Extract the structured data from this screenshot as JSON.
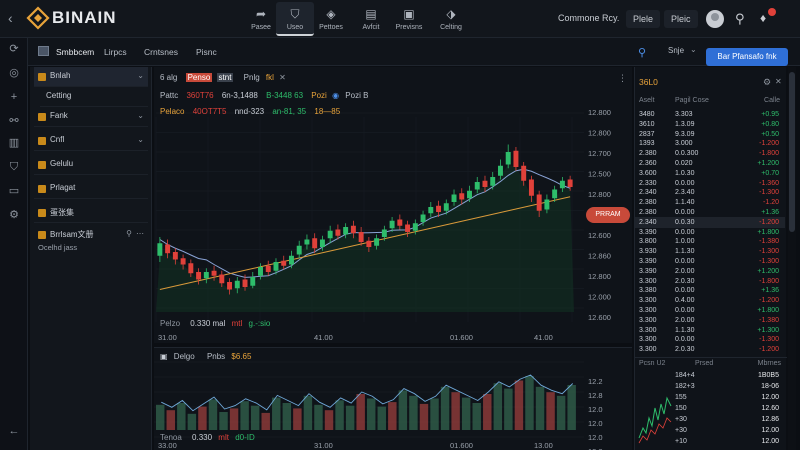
{
  "brand": {
    "name": "BINAIN"
  },
  "nav": [
    {
      "label": "Pasee",
      "icon": "share-icon"
    },
    {
      "label": "Useo",
      "icon": "shield-icon"
    },
    {
      "label": "Pettoes",
      "icon": "cube-icon"
    },
    {
      "label": "Avfcit",
      "icon": "document-icon"
    },
    {
      "label": "Previsns",
      "icon": "briefcase-icon"
    },
    {
      "label": "Celting",
      "icon": "tag-icon"
    }
  ],
  "topright": {
    "link": "Commone Rcy.",
    "btn1": "Plele",
    "btn2": "Pleic"
  },
  "tabs": [
    {
      "label": "Smbbcem"
    },
    {
      "label": "Lirpcs"
    },
    {
      "label": "Crntsnes"
    },
    {
      "label": "Pisnc"
    }
  ],
  "tabright": {
    "search_label": "Snje",
    "action_button": "Bar Pfansafo fnk"
  },
  "sidebar": {
    "items": [
      {
        "label": "Bnlah",
        "chevron": "⌄"
      },
      {
        "label": "Cetting",
        "chevron": ""
      },
      {
        "label": "Fank",
        "chevron": "⌄"
      },
      {
        "label": "Cnfl",
        "chevron": "⌄"
      },
      {
        "label": "Gelulu",
        "chevron": ""
      },
      {
        "label": "Prlagat",
        "chevron": ""
      },
      {
        "label": "蛋张集",
        "chevron": ""
      }
    ],
    "watch": {
      "title": "Brrlsam文册",
      "sub": "Ocelhd jass"
    }
  },
  "legend": {
    "row1": [
      "6 alg",
      "Penso",
      "stnt",
      "Pnlg",
      "fkl"
    ],
    "row2": [
      "Pattc",
      "360T76",
      "6n-3,1488",
      "B-3448 63",
      "Pozi",
      "Pozi B"
    ],
    "row3": [
      "Pelaco",
      "40OT7T5",
      "nnd-323",
      "an-81, 35",
      "18—85"
    ],
    "bottom": [
      "Pelzo",
      "0.330 mal",
      "mtl",
      "g.-:sio"
    ]
  },
  "lower_legend": {
    "row": [
      "Delgo",
      "Pnbs",
      "$6.65"
    ],
    "bottom": [
      "Tenoa",
      "0.330",
      "mlt",
      "d0-ID"
    ]
  },
  "chart_data": [
    {
      "type": "candlestick",
      "yaxis": [
        "12.800",
        "12.800",
        "12.700",
        "12.500",
        "12.800",
        "12.680",
        "12.600",
        "12.860",
        "12.800",
        "12.000",
        "12.600"
      ],
      "xaxis": [
        "31.00",
        "41.00",
        "01.600",
        "41.00"
      ],
      "last_price_label": "PRRAM",
      "candles": [
        [
          0,
          4.5,
          5.5,
          6.0,
          4.0
        ],
        [
          1,
          5.4,
          4.7,
          5.8,
          4.3
        ],
        [
          2,
          4.8,
          4.2,
          5.1,
          3.8
        ],
        [
          3,
          4.3,
          3.8,
          4.6,
          3.4
        ],
        [
          4,
          3.9,
          3.1,
          4.2,
          2.8
        ],
        [
          5,
          3.2,
          2.6,
          3.5,
          2.2
        ],
        [
          6,
          2.7,
          3.2,
          3.5,
          2.3
        ],
        [
          7,
          3.3,
          2.9,
          3.7,
          2.5
        ],
        [
          8,
          3.0,
          2.3,
          3.3,
          2.0
        ],
        [
          9,
          2.4,
          1.8,
          2.7,
          1.4
        ],
        [
          10,
          1.9,
          2.5,
          2.8,
          1.5
        ],
        [
          11,
          2.6,
          2.0,
          3.0,
          1.7
        ],
        [
          12,
          2.1,
          2.8,
          3.2,
          1.9
        ],
        [
          13,
          2.9,
          3.6,
          3.9,
          2.6
        ],
        [
          14,
          3.7,
          3.2,
          4.1,
          2.9
        ],
        [
          15,
          3.3,
          4.0,
          4.3,
          3.0
        ],
        [
          16,
          4.1,
          3.7,
          4.5,
          3.4
        ],
        [
          17,
          3.8,
          4.5,
          4.9,
          3.5
        ],
        [
          18,
          4.6,
          5.3,
          5.7,
          4.3
        ],
        [
          19,
          5.4,
          5.8,
          6.2,
          5.0
        ],
        [
          20,
          5.9,
          5.1,
          6.3,
          4.7
        ],
        [
          21,
          5.2,
          5.8,
          6.1,
          4.9
        ],
        [
          22,
          5.9,
          6.5,
          6.9,
          5.5
        ],
        [
          23,
          6.6,
          6.1,
          7.0,
          5.8
        ],
        [
          24,
          6.2,
          6.8,
          7.1,
          5.9
        ],
        [
          25,
          6.9,
          6.3,
          7.3,
          5.9
        ],
        [
          26,
          6.4,
          5.6,
          6.8,
          5.3
        ],
        [
          27,
          5.7,
          5.2,
          6.0,
          4.8
        ],
        [
          28,
          5.3,
          5.9,
          6.2,
          5.0
        ],
        [
          29,
          6.0,
          6.6,
          6.9,
          5.7
        ],
        [
          30,
          6.7,
          7.3,
          7.6,
          6.4
        ],
        [
          31,
          7.4,
          6.9,
          7.8,
          6.6
        ],
        [
          32,
          7.0,
          6.4,
          7.3,
          6.0
        ],
        [
          33,
          6.5,
          7.1,
          7.4,
          6.2
        ],
        [
          34,
          7.2,
          7.8,
          8.1,
          6.9
        ],
        [
          35,
          7.9,
          8.4,
          8.8,
          7.6
        ],
        [
          36,
          8.5,
          8.0,
          8.9,
          7.6
        ],
        [
          37,
          8.1,
          8.7,
          9.0,
          7.8
        ],
        [
          38,
          8.8,
          9.4,
          9.8,
          8.5
        ],
        [
          39,
          9.5,
          9.0,
          9.9,
          8.6
        ],
        [
          40,
          9.1,
          9.7,
          10.1,
          8.8
        ],
        [
          41,
          9.8,
          10.4,
          10.8,
          9.5
        ],
        [
          42,
          10.5,
          10.0,
          10.9,
          9.6
        ],
        [
          43,
          10.1,
          10.8,
          11.2,
          9.8
        ],
        [
          44,
          10.9,
          11.7,
          12.2,
          10.6
        ],
        [
          45,
          11.8,
          12.8,
          13.4,
          11.5
        ],
        [
          46,
          12.9,
          11.6,
          13.2,
          11.3
        ],
        [
          47,
          11.7,
          10.5,
          12.0,
          10.1
        ],
        [
          48,
          10.6,
          9.3,
          10.9,
          8.8
        ],
        [
          49,
          9.4,
          8.1,
          9.7,
          7.6
        ],
        [
          50,
          8.2,
          9.0,
          9.4,
          7.9
        ],
        [
          51,
          9.1,
          9.8,
          10.1,
          8.8
        ],
        [
          52,
          9.9,
          10.5,
          10.8,
          9.6
        ],
        [
          53,
          10.6,
          10.0,
          10.9,
          9.7
        ]
      ]
    },
    {
      "type": "bar",
      "yaxis": [
        "12.2",
        "12.8",
        "12.0",
        "12.0",
        "12.0",
        "12.8"
      ],
      "xaxis": [
        "33.00",
        "31.00",
        "01.600",
        "13.00"
      ]
    }
  ],
  "book": {
    "title": "36L0",
    "cols": [
      "Aselt",
      "Pagil Cose",
      "Calle"
    ],
    "rows": [
      [
        "3480",
        "3.303",
        "+0.95"
      ],
      [
        "3610",
        "1.3.09",
        "+0.80"
      ],
      [
        "2837",
        "9.3.09",
        "+0.50"
      ],
      [
        "1393",
        "3.000",
        "-1.200"
      ],
      [
        "2.380",
        "0.0.300",
        "-1.800"
      ],
      [
        "2.360",
        "0.020",
        "+1.200"
      ],
      [
        "3.600",
        "1.0.30",
        "+0.70"
      ],
      [
        "2.330",
        "0.0.00",
        "-1.360"
      ],
      [
        "2.340",
        "2.3.40",
        "-1.300"
      ],
      [
        "2.380",
        "1.1.40",
        "-1.20"
      ],
      [
        "2.380",
        "0.0.00",
        "+1.36"
      ],
      [
        "2.340",
        "0.0.30",
        "-1.200"
      ],
      [
        "3.390",
        "0.0.00",
        "+1.800"
      ],
      [
        "3.800",
        "1.0.00",
        "-1.380"
      ],
      [
        "3.930",
        "1.1.30",
        "-1.300"
      ],
      [
        "3.390",
        "0.0.00",
        "-1.300"
      ],
      [
        "3.390",
        "2.0.00",
        "+1.200"
      ],
      [
        "3.300",
        "2.0.30",
        "-1.800"
      ],
      [
        "3.380",
        "0.0.00",
        "+1.36"
      ],
      [
        "3.300",
        "0.4.00",
        "-1.200"
      ],
      [
        "3.300",
        "0.0.00",
        "+1.800"
      ],
      [
        "3.300",
        "2.0.00",
        "-1.380"
      ],
      [
        "3.300",
        "1.1.30",
        "+1.300"
      ],
      [
        "3.300",
        "0.0.00",
        "-1.300"
      ],
      [
        "3.300",
        "2.0.30",
        "-1.200"
      ]
    ],
    "bottom_cols": [
      "Pcsn U2",
      "Prsed",
      "Mbrnes"
    ],
    "bottom_rows": [
      [
        "184+4",
        "1B0B5"
      ],
      [
        "182+3",
        "18-06"
      ],
      [
        "155",
        "12.00"
      ],
      [
        "150",
        "12.60"
      ],
      [
        "+30",
        "12.86"
      ],
      [
        "+30",
        "12.00"
      ],
      [
        "+10",
        "12.00"
      ]
    ]
  },
  "colors": {
    "up": "#2ebd6b",
    "down": "#e0413a",
    "accent": "#e8a33a",
    "blue": "#2f6fd6"
  }
}
